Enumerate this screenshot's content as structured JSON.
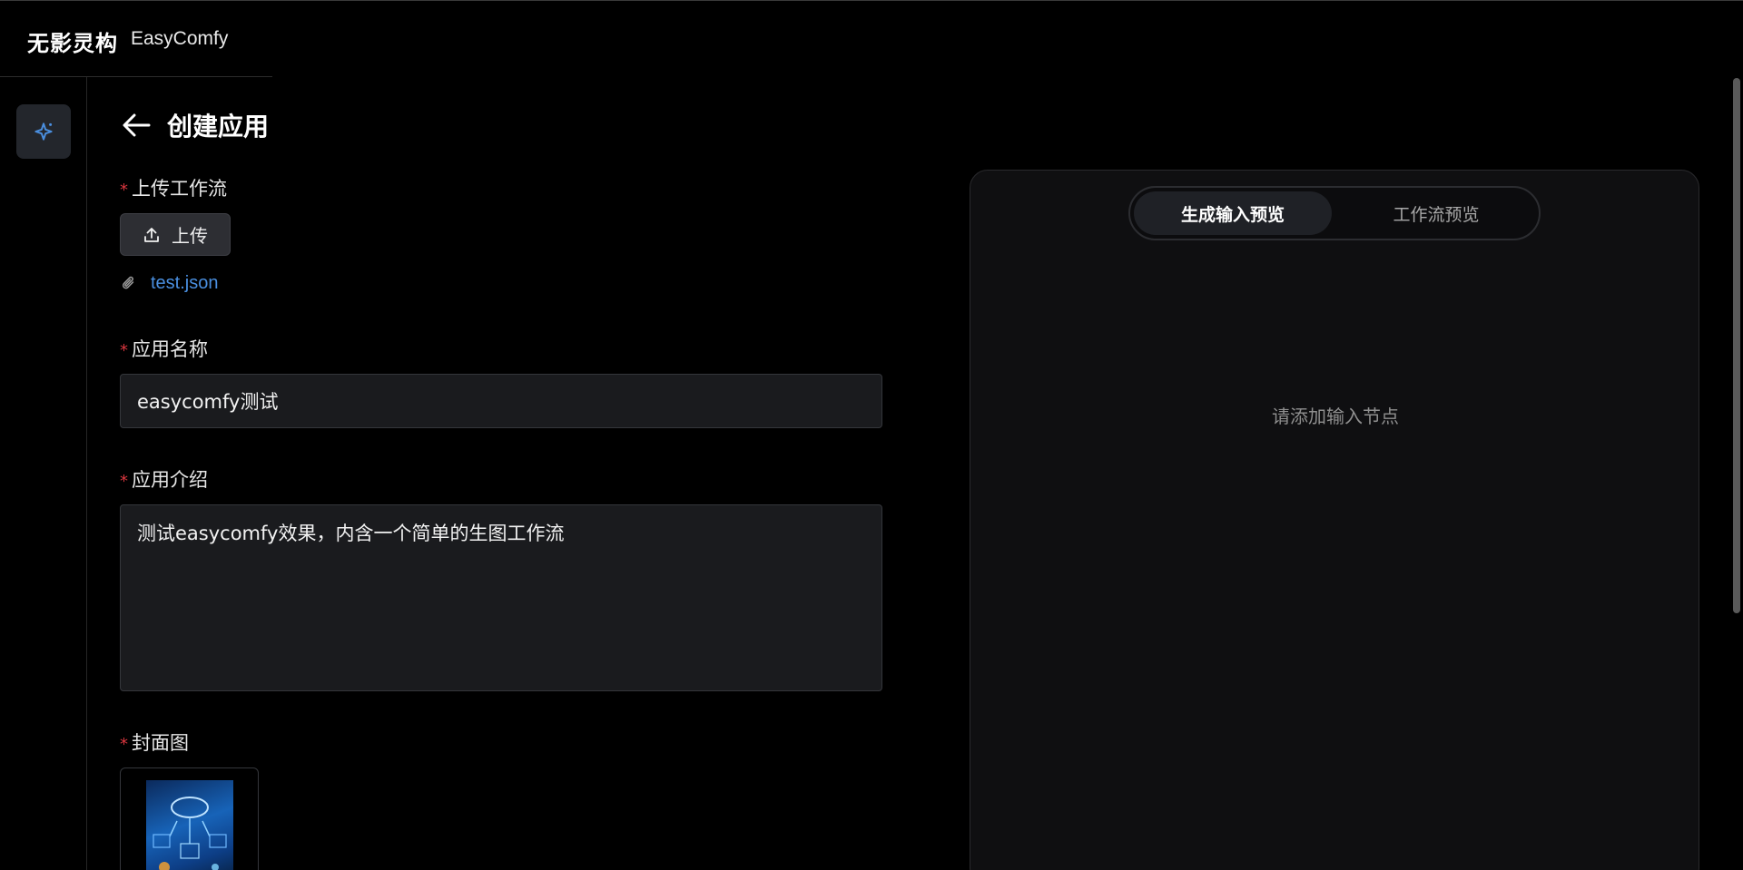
{
  "brand": {
    "name_cn": "无影灵构",
    "name_en": "EasyComfy"
  },
  "sidebar": {
    "items": [
      {
        "icon": "sparkle-icon",
        "active": true
      }
    ]
  },
  "page": {
    "title": "创建应用"
  },
  "form": {
    "required_mark": "*",
    "upload_workflow": {
      "label": "上传工作流",
      "button_label": "上传",
      "file_name": "test.json"
    },
    "app_name": {
      "label": "应用名称",
      "value": "easycomfy测试"
    },
    "app_intro": {
      "label": "应用介绍",
      "value": "测试easycomfy效果，内含一个简单的生图工作流"
    },
    "cover": {
      "label": "封面图"
    }
  },
  "preview": {
    "tabs": [
      {
        "label": "生成输入预览",
        "active": true
      },
      {
        "label": "工作流预览",
        "active": false
      }
    ],
    "empty_hint": "请添加输入节点"
  },
  "colors": {
    "accent": "#4a8fe0",
    "required": "#d9363e",
    "background": "#000000"
  }
}
